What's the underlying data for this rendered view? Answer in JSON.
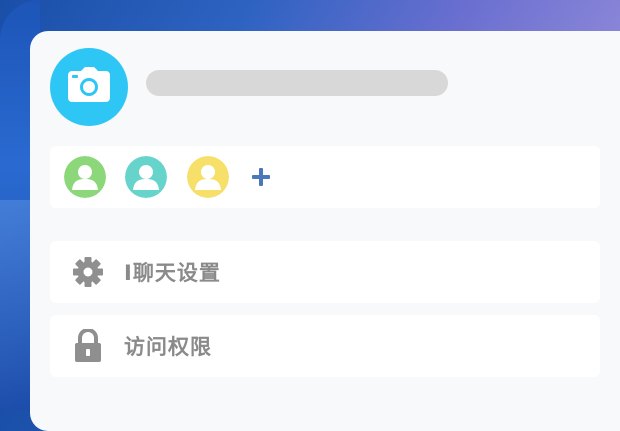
{
  "profile": {
    "avatar_icon": "camera-icon"
  },
  "members": [
    {
      "icon": "user-icon",
      "color": "#8cd77a"
    },
    {
      "icon": "user-icon",
      "color": "#66d4cb"
    },
    {
      "icon": "user-icon",
      "color": "#f7e06a"
    }
  ],
  "add_member": {
    "icon": "plus-icon",
    "color": "#4a78b8"
  },
  "menu": [
    {
      "icon": "gear-icon",
      "label": "I聊天设置"
    },
    {
      "icon": "lock-icon",
      "label": "访问权限"
    }
  ],
  "colors": {
    "avatar_bg": "#2ec7f5",
    "label_text": "#8a8a8a",
    "icon_gray": "#8f8f8f",
    "card_bg": "#f8f9fb",
    "placeholder": "#d8d8d8"
  }
}
